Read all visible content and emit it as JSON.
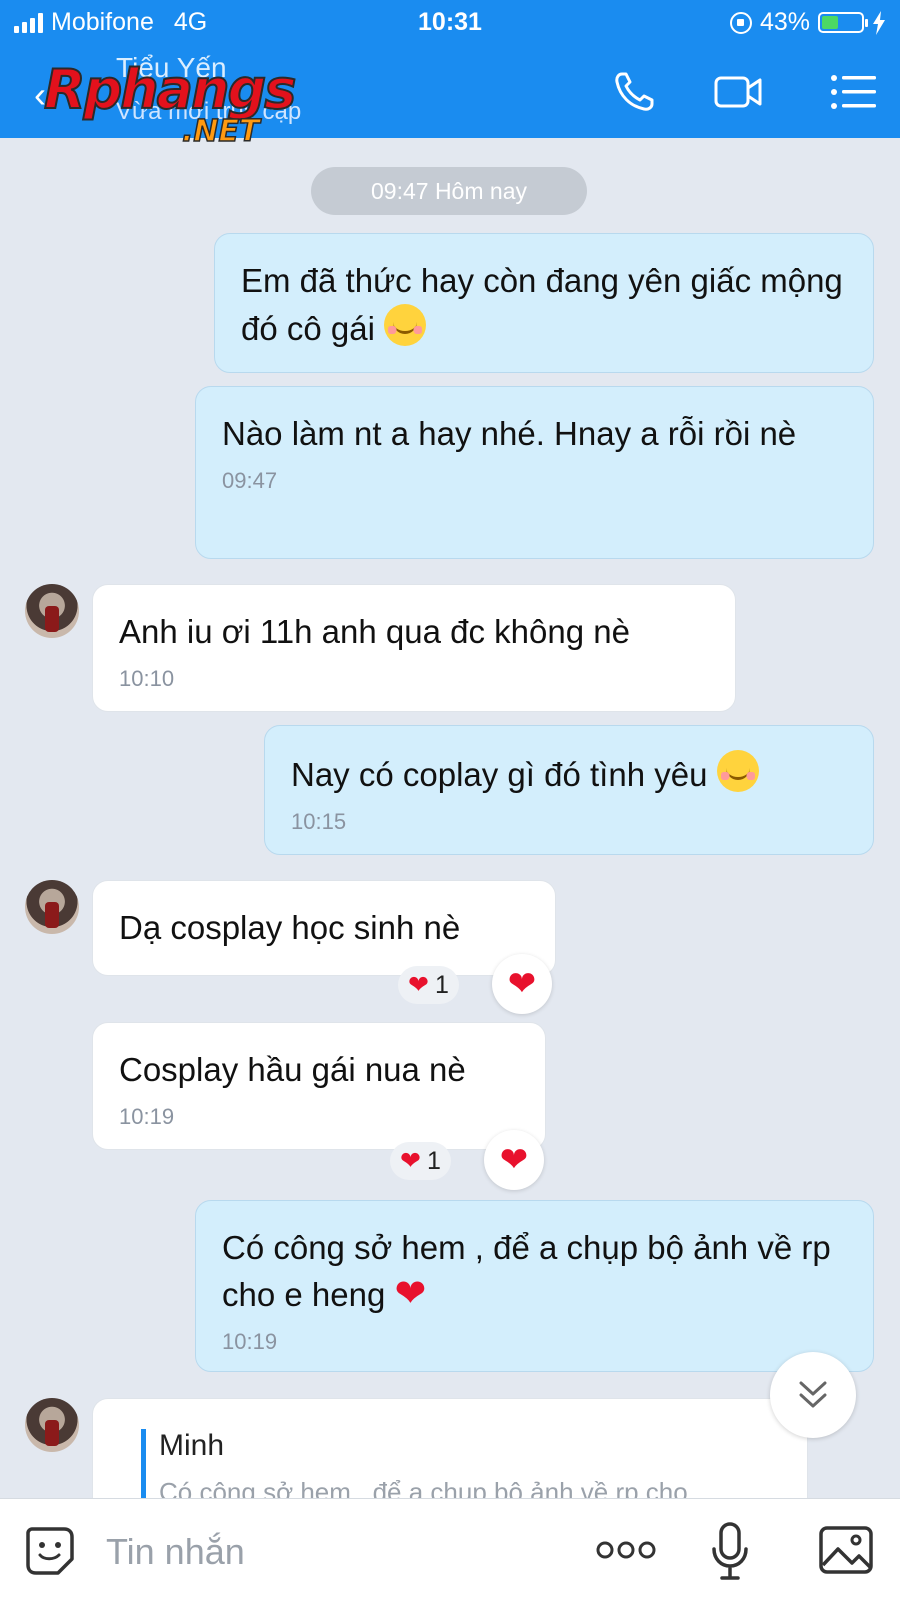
{
  "status_bar": {
    "carrier": "Mobifone",
    "network": "4G",
    "time": "10:31",
    "battery": "43%",
    "battery_level": 0.43
  },
  "header": {
    "contact_name": "Tiểu Yến",
    "contact_status": "Vừa mới truy cập",
    "watermark_main": "Rphangs",
    "watermark_sub": ".NET",
    "accent_color": "#1a8cf0"
  },
  "chat": {
    "date_separator": "09:47 Hôm nay",
    "messages": [
      {
        "dir": "out",
        "text": "Em đã thức hay còn đang yên giấc mộng đó cô gái",
        "emoji": "smiling-blush",
        "time": ""
      },
      {
        "dir": "out",
        "text": "Nào làm nt a hay nhé. Hnay a rỗi rồi nè",
        "time": "09:47"
      },
      {
        "dir": "in",
        "text": "Anh iu ơi 11h anh qua đc không nè",
        "time": "10:10"
      },
      {
        "dir": "out",
        "text": "Nay có coplay gì đó tình yêu",
        "emoji": "smiling-blush",
        "time": "10:15"
      },
      {
        "dir": "in",
        "text": "Dạ cosplay học sinh nè",
        "time": "",
        "reaction_count": "1"
      },
      {
        "dir": "in",
        "text": "Cosplay hầu gái nua nè",
        "time": "10:19",
        "reaction_count": "1"
      },
      {
        "dir": "out",
        "text": "Có công sở hem , để a chụp bộ ảnh về rp cho e heng",
        "emoji": "red-heart",
        "time": "10:19"
      }
    ],
    "reply_preview": {
      "name": "Minh",
      "text": "Có công sở hem , để a chụp bộ ảnh về rp cho..."
    }
  },
  "input": {
    "placeholder": "Tin nhắn"
  },
  "colors": {
    "outgoing_bubble": "#d3eefc",
    "incoming_bubble": "#ffffff",
    "heart": "#e8112d"
  }
}
